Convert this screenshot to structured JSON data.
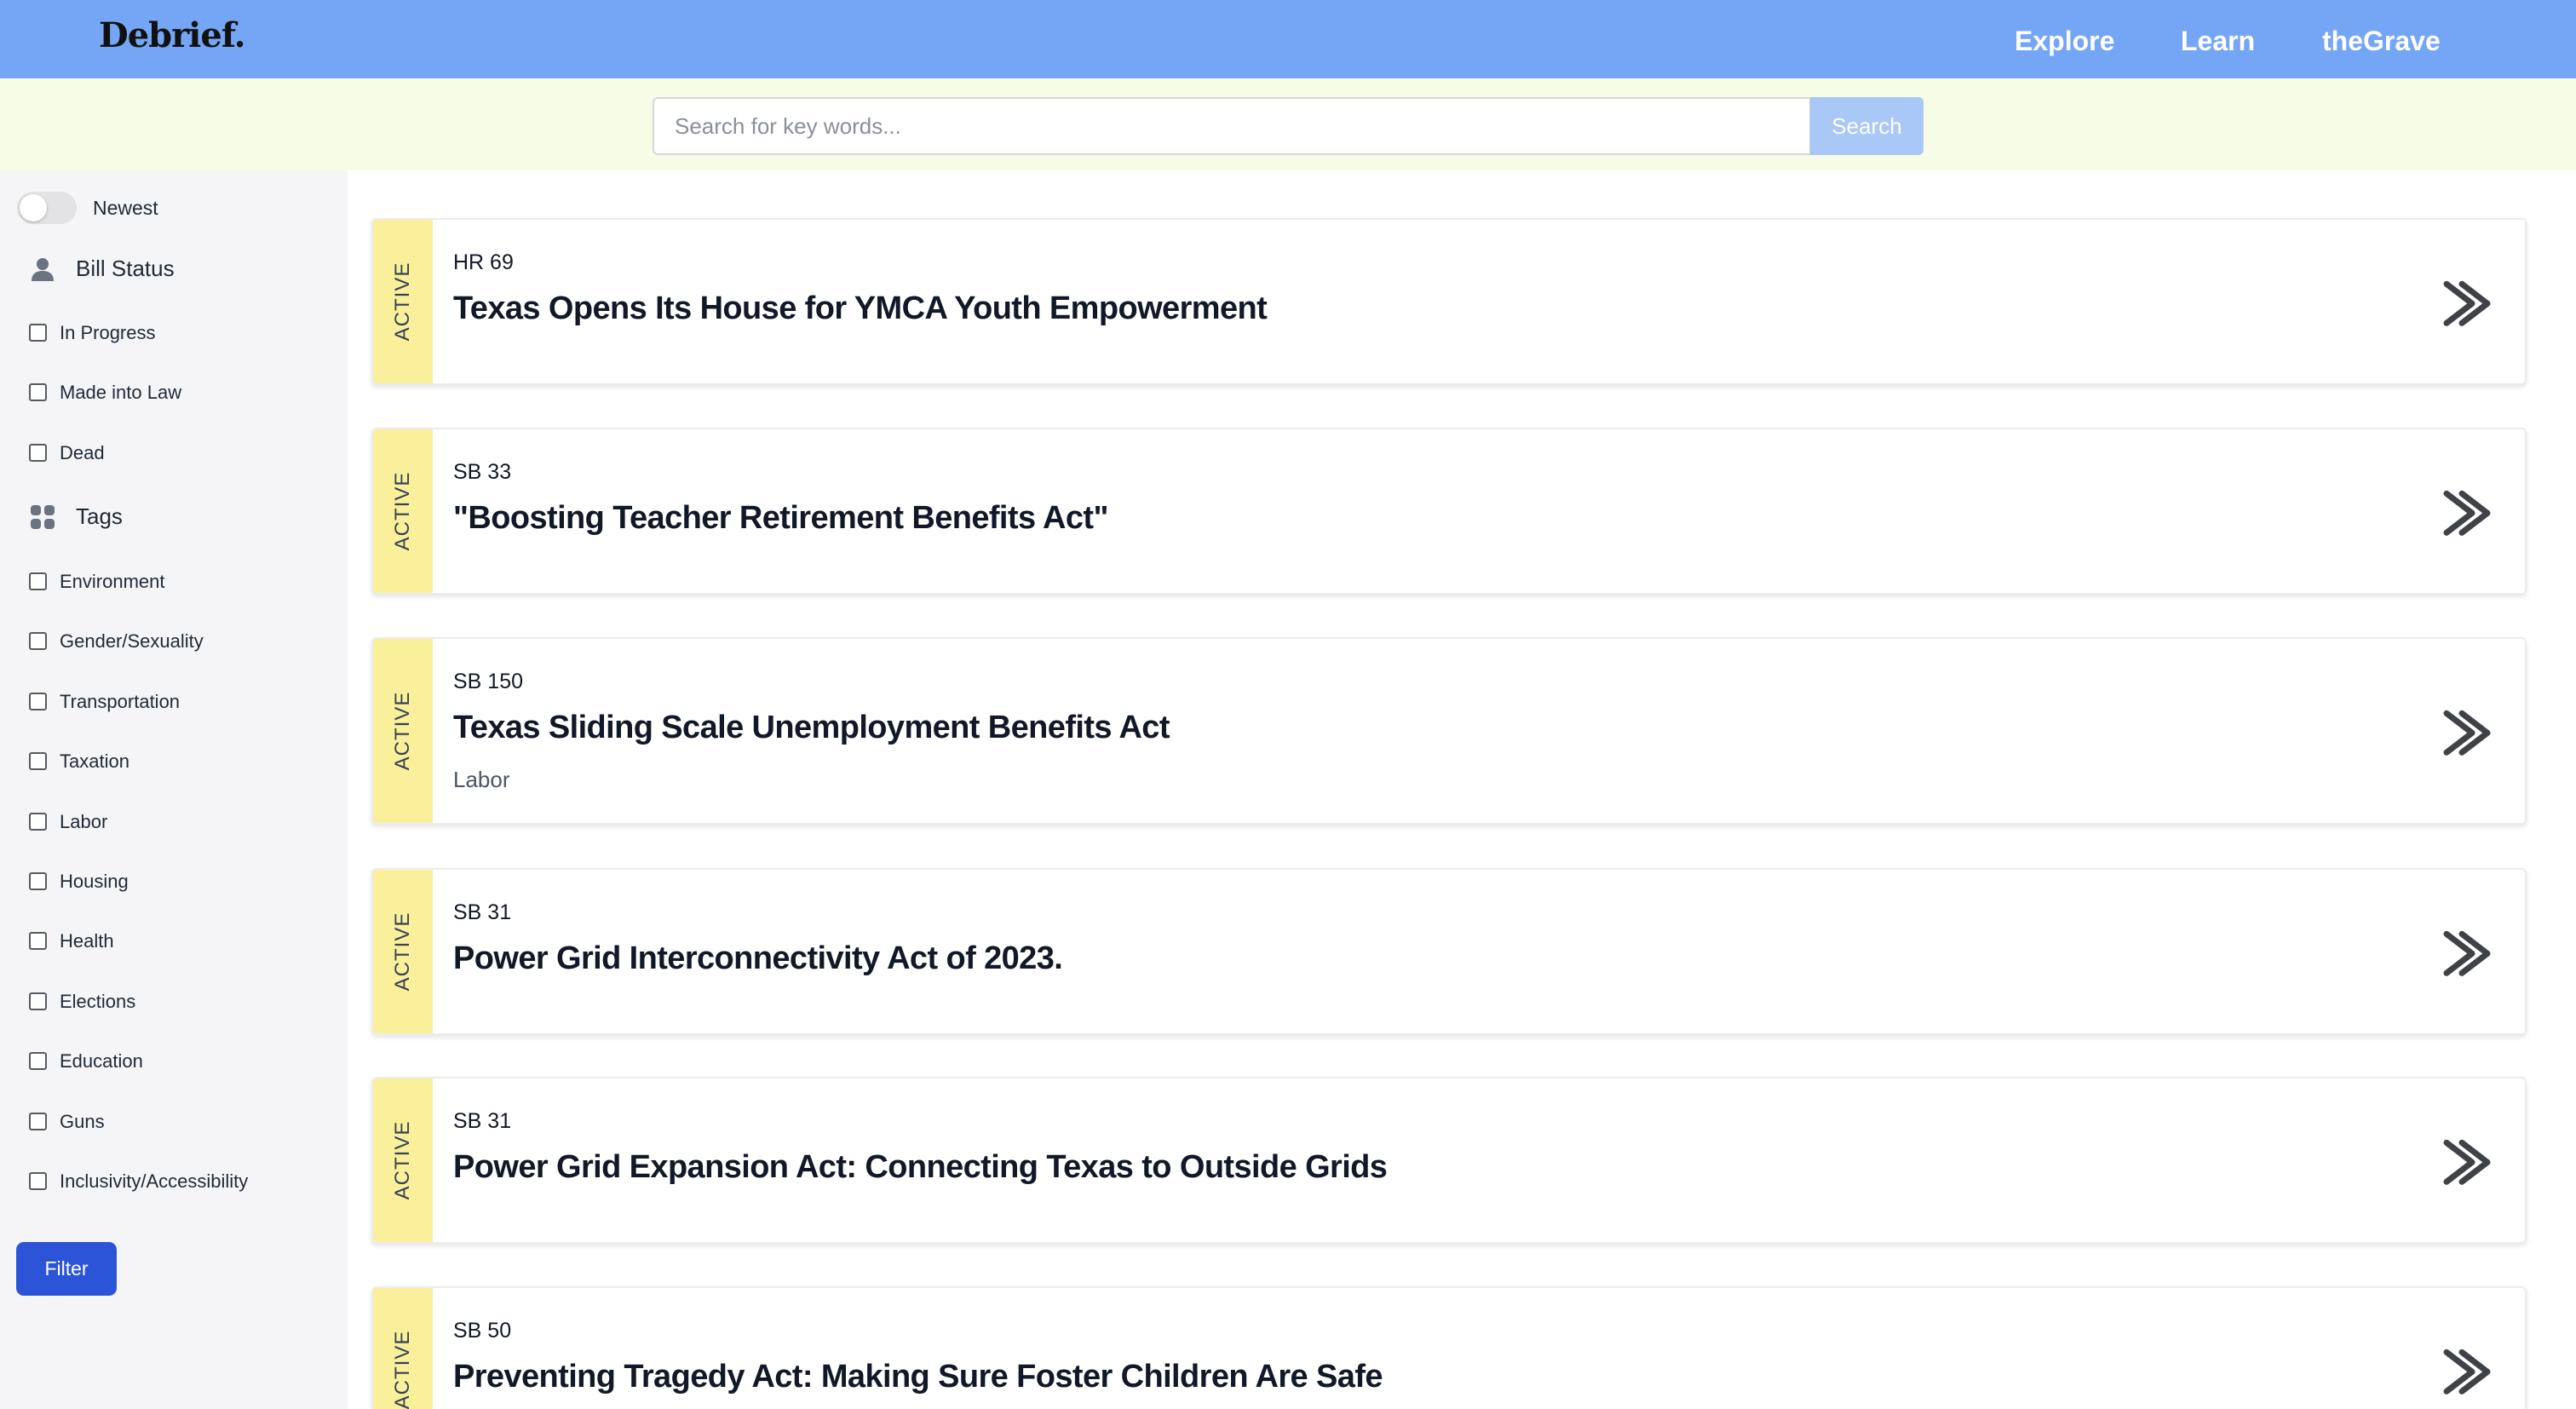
{
  "header": {
    "logo": "Debrief.",
    "nav": [
      "Explore",
      "Learn",
      "theGrave"
    ]
  },
  "search": {
    "placeholder": "Search for key words...",
    "button_label": "Search"
  },
  "sidebar": {
    "toggle_label": "Newest",
    "toggle_on": false,
    "status_heading": "Bill Status",
    "status_icon": "person-icon",
    "status_options": [
      "In Progress",
      "Made into Law",
      "Dead"
    ],
    "tags_heading": "Tags",
    "tags_icon": "grid-icon",
    "tag_options": [
      "Environment",
      "Gender/Sexuality",
      "Transportation",
      "Taxation",
      "Labor",
      "Housing",
      "Health",
      "Elections",
      "Education",
      "Guns",
      "Inclusivity/Accessibility"
    ],
    "filter_label": "Filter"
  },
  "bills": [
    {
      "status": "ACTIVE",
      "number": "HR 69",
      "title": "Texas Opens Its House for YMCA Youth Empowerment",
      "tag": ""
    },
    {
      "status": "ACTIVE",
      "number": "SB 33",
      "title": "\"Boosting Teacher Retirement Benefits Act\"",
      "tag": ""
    },
    {
      "status": "ACTIVE",
      "number": "SB 150",
      "title": "Texas Sliding Scale Unemployment Benefits Act",
      "tag": "Labor"
    },
    {
      "status": "ACTIVE",
      "number": "SB 31",
      "title": "Power Grid Interconnectivity Act of 2023.",
      "tag": ""
    },
    {
      "status": "ACTIVE",
      "number": "SB 31",
      "title": "Power Grid Expansion Act: Connecting Texas to Outside Grids",
      "tag": ""
    },
    {
      "status": "ACTIVE",
      "number": "SB 50",
      "title": "Preventing Tragedy Act: Making Sure Foster Children Are Safe",
      "tag": ""
    }
  ],
  "colors": {
    "header_bg": "#74a6f5",
    "search_band_bg": "#f7fce6",
    "status_stripe": "#faef9b",
    "filter_button": "#2b55d6",
    "search_button": "#a9c8f7"
  }
}
